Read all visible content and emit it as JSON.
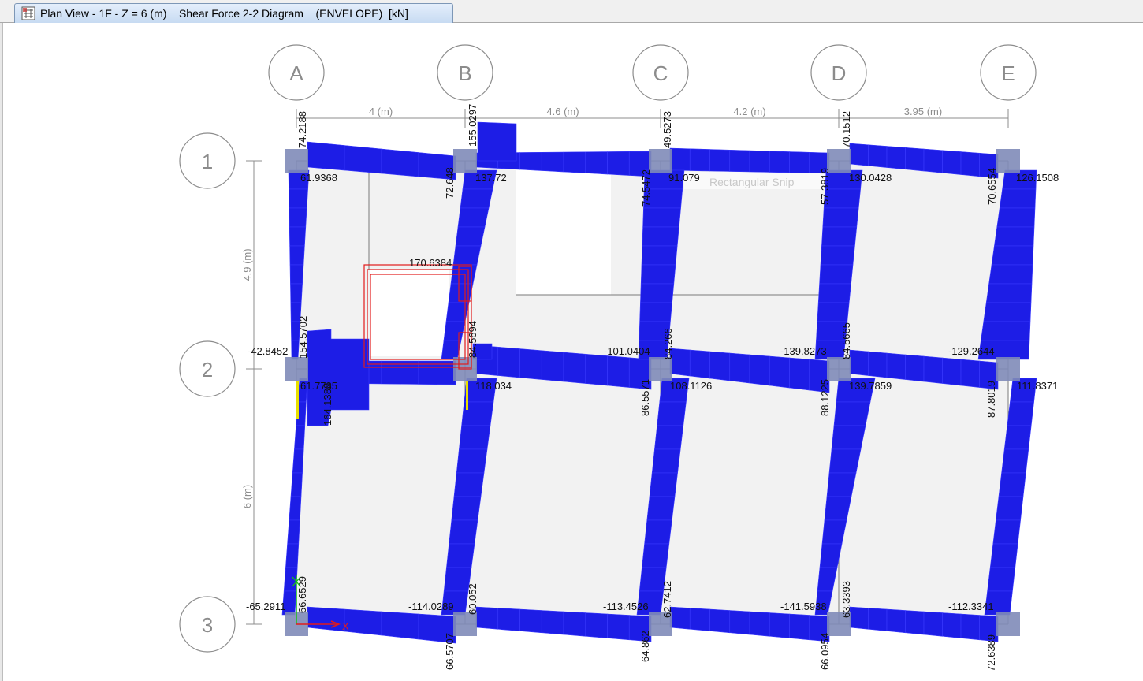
{
  "window": {
    "tab_title": "Plan View - 1F - Z = 6 (m)    Shear Force 2-2 Diagram    (ENVELOPE)  [kN]"
  },
  "colors": {
    "diagram_fill": "#1d1de6",
    "column": "#7f8bb8",
    "slab": "#f2f2f2",
    "selection": "#e21b1b",
    "grid_line": "#8c8c8c"
  },
  "grid": {
    "columns": [
      "A",
      "B",
      "C",
      "D",
      "E"
    ],
    "rows": [
      "1",
      "2",
      "3"
    ],
    "x_spacings": [
      "4 (m)",
      "4.6 (m)",
      "4.2 (m)",
      "3.95 (m)"
    ],
    "y_spacings": [
      "4.9 (m)",
      "6 (m)"
    ]
  },
  "value_labels": [
    "74.2188",
    "155.0297",
    "49.5273",
    "70.1512",
    "61.9368",
    "72.648",
    "137.72",
    "74.5472",
    "91.079",
    "57.3819",
    "130.0428",
    "70.6554",
    "126.1508",
    "170.6384",
    "154.5702",
    "-42.8452",
    "84.5694",
    "-101.0404",
    "84.266",
    "-139.8273",
    "84.5665",
    "-129.2644",
    "61.7735",
    "164.1388",
    "118.034",
    "86.5571",
    "108.1126",
    "88.1225",
    "139.7859",
    "87.8019",
    "111.8371",
    "66.6529",
    "-65.2911",
    "-114.0289",
    "60.052",
    "-113.4526",
    "62.7412",
    "-141.5938",
    "63.3393",
    "-112.3341",
    "66.5707",
    "64.862",
    "66.0954",
    "72.6389"
  ],
  "overlay_text": "Rectangular Snip",
  "axes": {
    "x": "X"
  }
}
